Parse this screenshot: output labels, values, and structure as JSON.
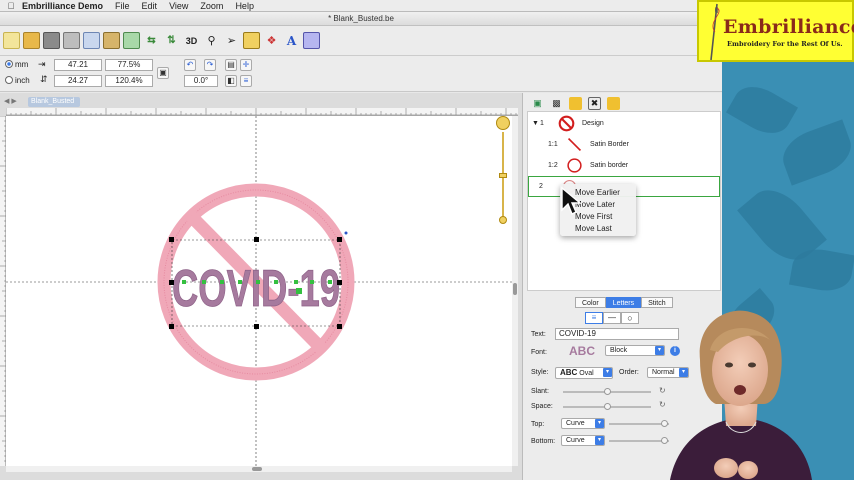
{
  "menubar": {
    "app_name": "Embrilliance Demo",
    "items": [
      "File",
      "Edit",
      "View",
      "Zoom",
      "Help"
    ]
  },
  "window": {
    "title": "* Blank_Busted.be"
  },
  "measurements": {
    "unit_mm": "mm",
    "unit_inch": "inch",
    "width_value": "47.21",
    "width_percent": "77.5%",
    "height_value": "24.27",
    "height_percent": "120.4%",
    "rotation": "0.0°"
  },
  "canvas": {
    "document_tab": "Blank_Busted",
    "design_text": "COVID-19"
  },
  "sequence": {
    "rows": [
      {
        "num": "1",
        "label": "Design"
      },
      {
        "num": "1:1",
        "label": "Satin Border"
      },
      {
        "num": "1:2",
        "label": "Satin border"
      },
      {
        "num": "2",
        "label": ""
      }
    ]
  },
  "context_menu": {
    "items": [
      "Move Earlier",
      "Move Later",
      "Move First",
      "Move Last"
    ]
  },
  "properties": {
    "tabs": [
      "Color",
      "Letters",
      "Stitch"
    ],
    "active_tab": "Letters",
    "text_label": "Text:",
    "text_value": "COVID-19",
    "font_label": "Font:",
    "font_preview": "ABC",
    "font_value": "Block",
    "style_label": "Style:",
    "style_preview": "ABC",
    "style_value": "Oval",
    "order_label": "Order:",
    "order_value": "Normal",
    "slant_label": "Slant:",
    "space_label": "Space:",
    "top_label": "Top:",
    "top_value": "Curve",
    "bottom_label": "Bottom:",
    "bottom_value": "Curve"
  },
  "logo": {
    "title": "Embrilliance",
    "tagline": "Embroidery For the Rest Of Us."
  },
  "colors": {
    "accent_blue": "#3d7de6",
    "selection_green": "#3aa640",
    "design_pink": "#f0a8b8",
    "text_mauve": "#a67a9e",
    "logo_yellow": "#ffff33"
  }
}
